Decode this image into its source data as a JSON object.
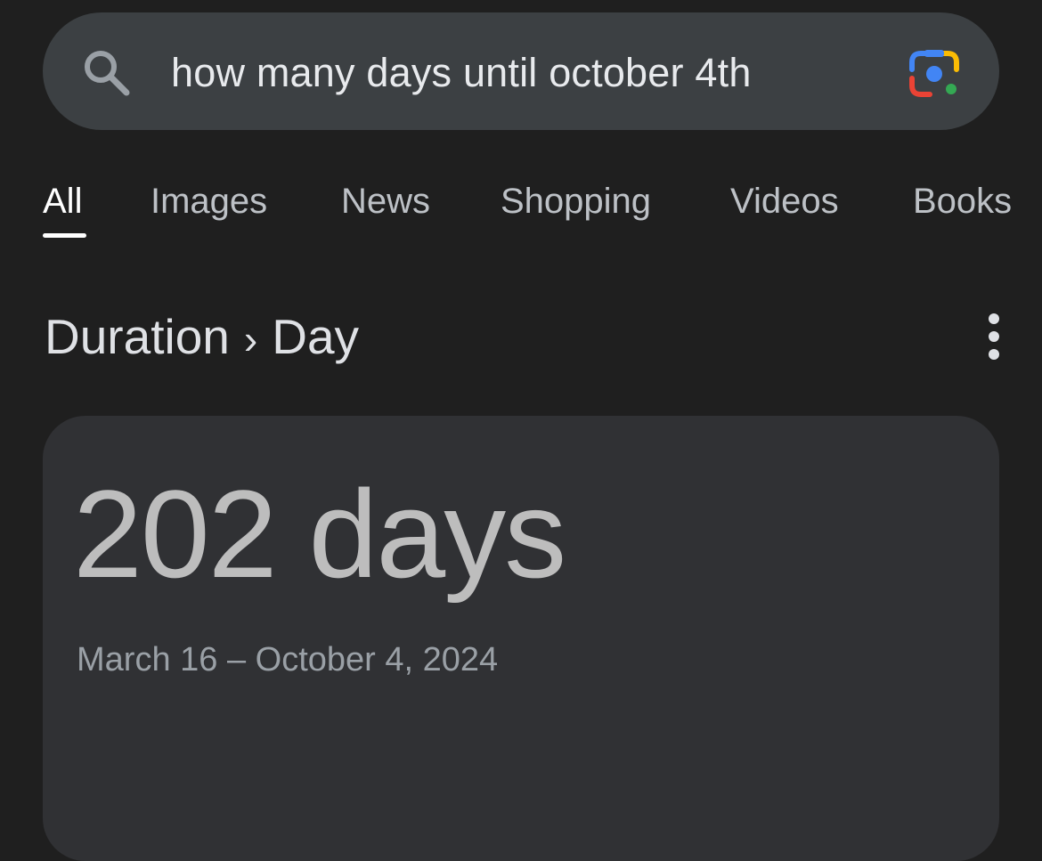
{
  "search": {
    "query": "how many days until october 4th"
  },
  "tabs": [
    {
      "label": "All",
      "active": true
    },
    {
      "label": "Images",
      "active": false
    },
    {
      "label": "News",
      "active": false
    },
    {
      "label": "Shopping",
      "active": false
    },
    {
      "label": "Videos",
      "active": false
    },
    {
      "label": "Books",
      "active": false
    }
  ],
  "breadcrumb": {
    "parent": "Duration",
    "separator": "›",
    "current": "Day"
  },
  "result": {
    "value": "202 days",
    "range": "March 16 – October 4, 2024"
  },
  "icons": {
    "search": "search-icon",
    "lens": "google-lens-icon",
    "more": "more-vert-icon"
  },
  "colors": {
    "background": "#1f1f1f",
    "search_bar": "#3c4043",
    "card": "#303134",
    "active_tab": "#ffffff",
    "inactive_tab": "#bdc1c6"
  }
}
